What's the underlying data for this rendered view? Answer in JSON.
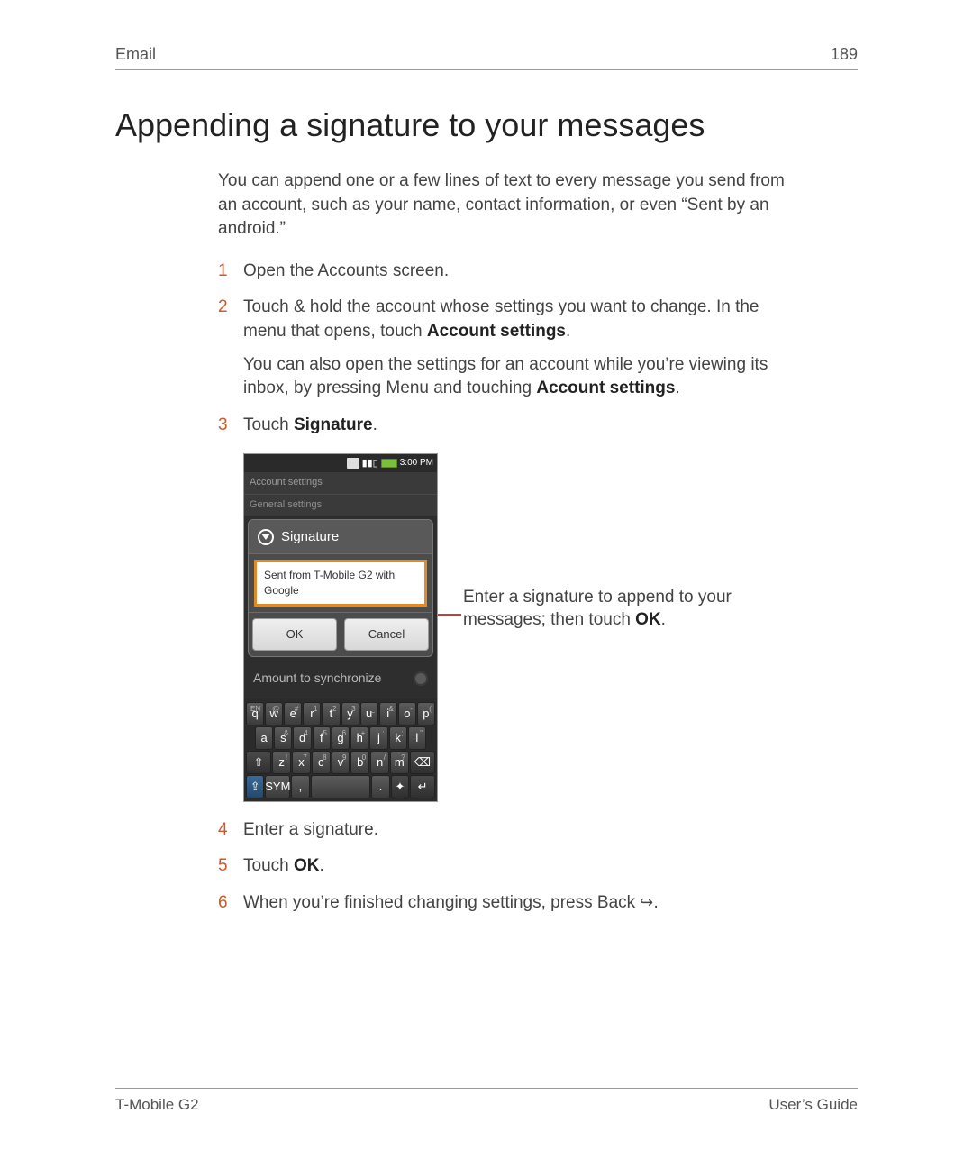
{
  "header": {
    "section": "Email",
    "page_number": "189"
  },
  "title": "Appending a signature to your messages",
  "intro": "You can append one or a few lines of text to every message you send from an account, such as your name, contact information, or even “Sent by an android.”",
  "steps": {
    "s1": "Open the Accounts screen.",
    "s2_a": "Touch & hold the account whose settings you want to change. In the menu that opens, touch ",
    "s2_b": "Account settings",
    "s2_c": ".",
    "s2_sub_a": "You can also open the settings for an account while you’re viewing its inbox, by pressing ",
    "s2_sub_menu": "Menu",
    "s2_sub_b": " and touching ",
    "s2_sub_bold": "Account settings",
    "s2_sub_c": ".",
    "s3_a": "Touch ",
    "s3_b": "Signature",
    "s3_c": ".",
    "s4": "Enter a signature.",
    "s5_a": "Touch ",
    "s5_b": "OK",
    "s5_c": ".",
    "s6_a": "When you’re finished changing settings, press ",
    "s6_back": "Back",
    "s6_b": " "
  },
  "phone": {
    "time": "3:00 PM",
    "breadcrumb": "Account settings",
    "section_header": "General settings",
    "dialog_title": "Signature",
    "signature_value": "Sent from T-Mobile G2 with Google",
    "ok": "OK",
    "cancel": "Cancel",
    "sync_label": "Amount to synchronize",
    "keyboard": {
      "row1_sup": [
        "EN",
        "@",
        "#",
        "1",
        "2",
        "3",
        "_",
        "&",
        "-",
        "("
      ],
      "row1": [
        "q",
        "w",
        "e",
        "r",
        "t",
        "y",
        "u",
        "i",
        "o",
        "p"
      ],
      "row2_sup": [
        "",
        "&",
        "4",
        "5",
        "6",
        "+",
        ":",
        ";",
        "\""
      ],
      "row2": [
        "a",
        "s",
        "d",
        "f",
        "g",
        "h",
        "j",
        "k",
        "l"
      ],
      "row3_sup": [
        "",
        "!",
        "7",
        "8",
        "9",
        "0",
        "/",
        "?",
        ""
      ],
      "row3": [
        "⇧",
        "z",
        "x",
        "c",
        "v",
        "b",
        "n",
        "m",
        "⌫"
      ],
      "row4": [
        "⇪",
        "SYM",
        ",",
        "space",
        ".",
        "✦",
        "↵"
      ]
    }
  },
  "callout_a": "Enter a signature to append to your messages; then touch ",
  "callout_b": "OK",
  "callout_c": ".",
  "footer": {
    "left": "T-Mobile G2",
    "right": "User’s Guide"
  }
}
